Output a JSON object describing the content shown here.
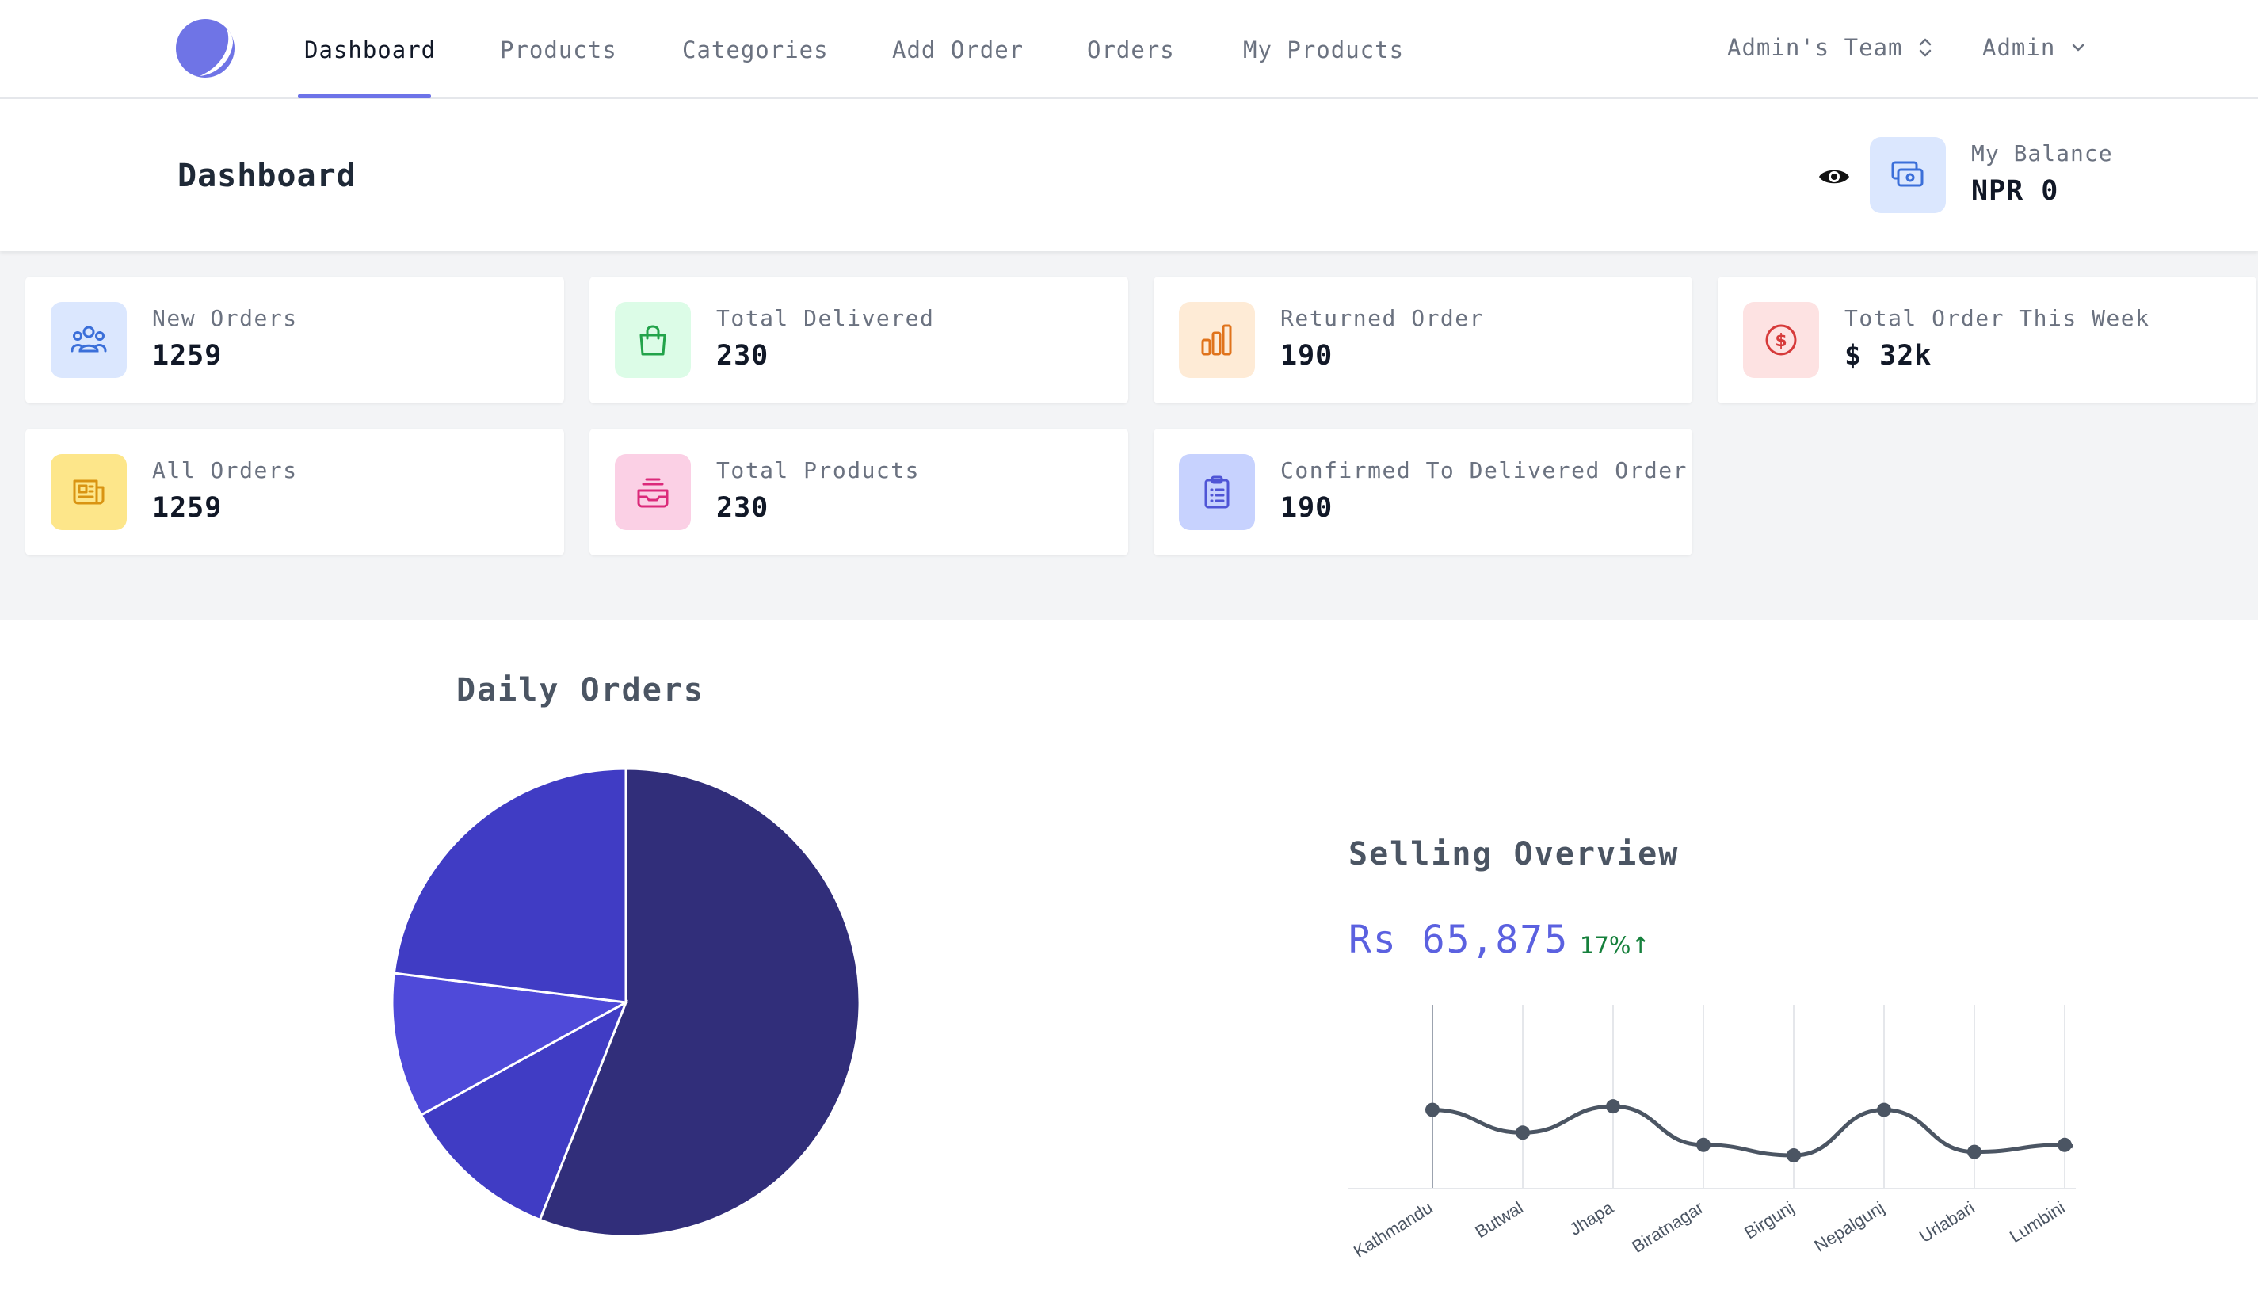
{
  "nav": {
    "items": [
      {
        "label": "Dashboard",
        "active": true
      },
      {
        "label": "Products",
        "active": false
      },
      {
        "label": "Categories",
        "active": false
      },
      {
        "label": "Add Order",
        "active": false
      },
      {
        "label": "Orders",
        "active": false
      },
      {
        "label": "My Products",
        "active": false
      }
    ],
    "team": "Admin's Team",
    "user": "Admin"
  },
  "header": {
    "title": "Dashboard",
    "balance_label": "My Balance",
    "balance_value": "NPR 0"
  },
  "stats": [
    {
      "label": "New Orders",
      "value": "1259",
      "icon": "users-icon",
      "bg": "#dbe7fe",
      "fg": "#3b6fd9"
    },
    {
      "label": "Total Delivered",
      "value": "230",
      "icon": "shopping-bag-icon",
      "bg": "#dcfce7",
      "fg": "#22a34a"
    },
    {
      "label": "Returned Order",
      "value": "190",
      "icon": "bar-chart-icon",
      "bg": "#feebd6",
      "fg": "#e0731c"
    },
    {
      "label": "Total Order This Week",
      "value": "$ 32k",
      "icon": "dollar-icon",
      "bg": "#fde2e2",
      "fg": "#d63a3a"
    },
    {
      "label": "All Orders",
      "value": "1259",
      "icon": "newspaper-icon",
      "bg": "#fde68a",
      "fg": "#d99412"
    },
    {
      "label": "Total Products",
      "value": "230",
      "icon": "inbox-stack-icon",
      "bg": "#fbd0e5",
      "fg": "#db2a7a"
    },
    {
      "label": "Confirmed To Delivered Order",
      "value": "190",
      "icon": "clipboard-list-icon",
      "bg": "#c7d2fe",
      "fg": "#4f55d6"
    }
  ],
  "colors": {
    "accent": "#6d73e8",
    "pie": [
      "#312e7a",
      "#403cc4",
      "#4f4ad9",
      "#403cc4"
    ],
    "line": "#4b5563"
  },
  "daily_orders": {
    "title": "Daily Orders"
  },
  "selling": {
    "title": "Selling Overview",
    "amount": "Rs 65,875",
    "change": "17%↑"
  },
  "chart_data": [
    {
      "type": "pie",
      "title": "Daily Orders",
      "values": [
        56,
        11,
        10,
        23
      ]
    },
    {
      "type": "line",
      "title": "Selling Overview",
      "categories": [
        "Kathmandu",
        "Butwal",
        "Jhapa",
        "Biratnagar",
        "Birgunj",
        "Nepalgunj",
        "Urlabari",
        "Lumbini"
      ],
      "values": [
        40,
        27,
        42,
        20,
        14,
        40,
        16,
        20
      ],
      "ylim": [
        -5,
        100
      ],
      "grid": true
    }
  ]
}
